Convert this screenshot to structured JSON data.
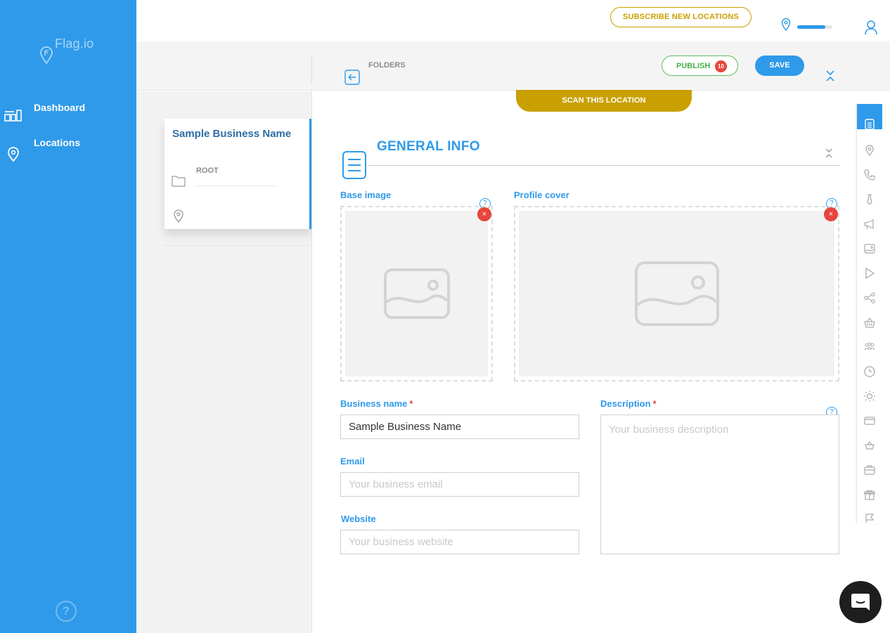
{
  "brand": {
    "name": "Flag.io"
  },
  "sidebar": {
    "items": [
      {
        "label": "Dashboard",
        "icon": "dashboard-icon"
      },
      {
        "label": "Locations",
        "icon": "location-pin-icon"
      }
    ],
    "help": "?"
  },
  "topbar": {
    "subscribe_label": "SUBSCRIBE NEW LOCATIONS",
    "location_progress": 0.8
  },
  "toolbar": {
    "folders_label": "FOLDERS",
    "publish_label": "PUBLISH",
    "publish_count": "10",
    "save_label": "SAVE"
  },
  "location_card": {
    "title": "Sample Business Name",
    "folder": "ROOT"
  },
  "main": {
    "scan_label": "SCAN THIS LOCATION",
    "section_title": "GENERAL INFO",
    "base_image_label": "Base image",
    "profile_cover_label": "Profile cover",
    "help_mark": "?",
    "remove_mark": "×",
    "business_name": {
      "label": "Business name",
      "required": "*",
      "value": "Sample Business Name"
    },
    "email": {
      "label": "Email",
      "placeholder": "Your business email"
    },
    "website": {
      "label": "Website",
      "placeholder": "Your business website"
    },
    "description": {
      "label": "Description",
      "required": "*",
      "placeholder": "Your business description"
    }
  },
  "rail": {
    "icons": [
      "document-icon",
      "location-pin-icon",
      "phone-icon",
      "tie-icon",
      "megaphone-icon",
      "image-icon",
      "play-icon",
      "share-icon",
      "basket-icon",
      "people-icon",
      "clock-icon",
      "sun-icon",
      "credit-card-icon",
      "cart-icon",
      "briefcase-icon",
      "gift-icon",
      "flag-icon"
    ]
  },
  "colors": {
    "primary": "#2f9ae9",
    "gold": "#c9a000",
    "green": "#49b249",
    "red": "#e8453c"
  }
}
